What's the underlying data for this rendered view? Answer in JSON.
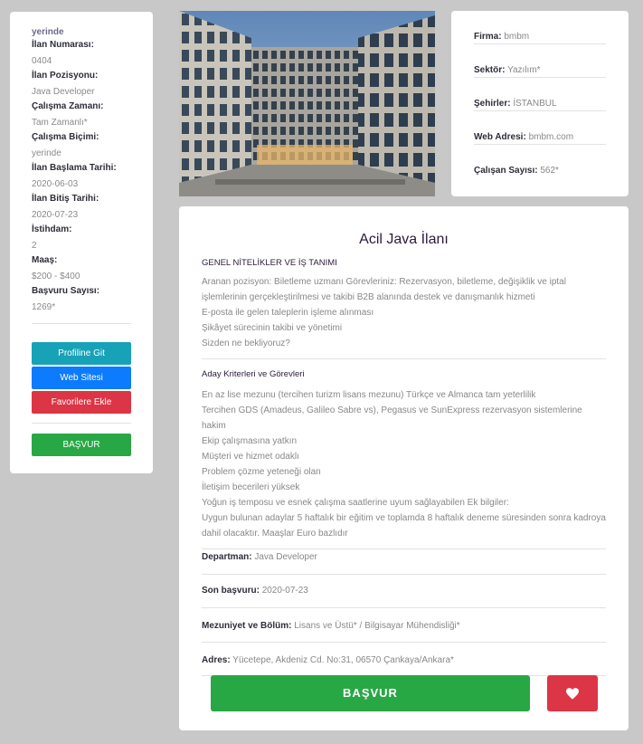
{
  "left": {
    "top_value": "yerinde",
    "fields": [
      {
        "label": "İlan Numarası:",
        "value": "0404"
      },
      {
        "label": "İlan Pozisyonu:",
        "value": "Java Developer"
      },
      {
        "label": "Çalışma Zamanı:",
        "value": "Tam Zamanlı*"
      },
      {
        "label": "Çalışma Biçimi:",
        "value": "yerinde"
      },
      {
        "label": "İlan Başlama Tarihi:",
        "value": "2020-06-03"
      },
      {
        "label": "İlan Bitiş Tarihi:",
        "value": "2020-07-23"
      },
      {
        "label": "İstihdam:",
        "value": "2"
      },
      {
        "label": "Maaş:",
        "value": "$200 - $400"
      },
      {
        "label": "Başvuru Sayısı:",
        "value": "1269*"
      }
    ],
    "buttons": {
      "profile": "Profiline Git",
      "website": "Web Sitesi",
      "favorites": "Favorilere Ekle",
      "apply": "BAŞVUR"
    }
  },
  "company": {
    "rows": [
      {
        "label": "Firma:",
        "value": "bmbm"
      },
      {
        "label": "Sektör:",
        "value": "Yazılım*"
      },
      {
        "label": "Şehirler:",
        "value": "İSTANBUL"
      },
      {
        "label": "Web Adresi:",
        "value": "bmbm.com"
      },
      {
        "label": "Çalışan Sayısı:",
        "value": "562*"
      }
    ]
  },
  "main": {
    "title": "Acil Java İlanı",
    "section1": {
      "heading": "GENEL NİTELİKLER VE İŞ TANIMI",
      "lines": [
        "Aranan pozisyon: Biletleme uzmanı Görevleriniz: Rezervasyon, biletleme, değişiklik ve iptal",
        "işlemlerinin gerçekleştirilmesi ve takibi B2B alanında destek ve danışmanlık hizmeti",
        "E-posta ile gelen taleplerin işleme alınması",
        "Şikâyet sürecinin takibi ve yönetimi",
        "Sizden ne bekliyoruz?"
      ]
    },
    "section2": {
      "heading": "Aday Kriterleri ve Görevleri",
      "lines": [
        "En az lise mezunu (tercihen turizm lisans mezunu) Türkçe ve Almanca tam yeterlilik",
        "Tercihen GDS (Amadeus, Galileo Sabre vs), Pegasus ve SunExpress rezervasyon sistemlerine hakim",
        "Ekip çalışmasına yatkın",
        "Müşteri ve hizmet odaklı",
        "Problem çözme yeteneği olan",
        "İletişim becerileri yüksek",
        "Yoğun iş temposu ve esnek çalışma saatlerine uyum sağlayabilen Ek bilgiler:",
        "Uygun bulunan adaylar 5 haftalık bir eğitim ve toplamda 8 haftalık deneme süresinden sonra kadroya",
        "dahil olacaktır. Maaşlar Euro bazlıdır"
      ]
    },
    "fields": [
      {
        "label": "Departman:",
        "value": "Java Developer"
      },
      {
        "label": "Son başvuru:",
        "value": "2020-07-23"
      },
      {
        "label": "Mezuniyet ve Bölüm:",
        "value": "Lisans ve Üstü* / Bilgisayar Mühendisliği*"
      },
      {
        "label": "Adres:",
        "value": "Yücetepe, Akdeniz Cd. No:31, 06570 Çankaya/Ankara*"
      }
    ],
    "apply_label": "BAŞVUR",
    "favorite_icon": "heart-icon"
  },
  "colors": {
    "teal": "#17a2b8",
    "blue": "#0d7bfd",
    "red": "#dc3545",
    "green": "#28a745"
  }
}
